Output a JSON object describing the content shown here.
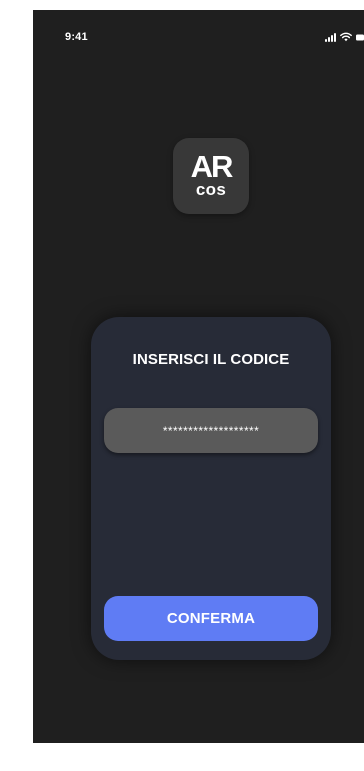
{
  "status_bar": {
    "time": "9:41",
    "icons": [
      "cellular-signal-icon",
      "wifi-icon",
      "battery-icon"
    ]
  },
  "logo": {
    "top_text": "AR",
    "bottom_text": "cos"
  },
  "login_card": {
    "title": "INSERISCI IL CODICE",
    "code_field": {
      "value": "*******************"
    },
    "confirm_label": "CONFERMA"
  },
  "colors": {
    "screen_background": "#1f1f1f",
    "card_background": "#272b37",
    "input_background": "#5a5a5a",
    "accent_button": "#5f7cf4",
    "logo_tile": "#383838",
    "text": "#ffffff"
  }
}
